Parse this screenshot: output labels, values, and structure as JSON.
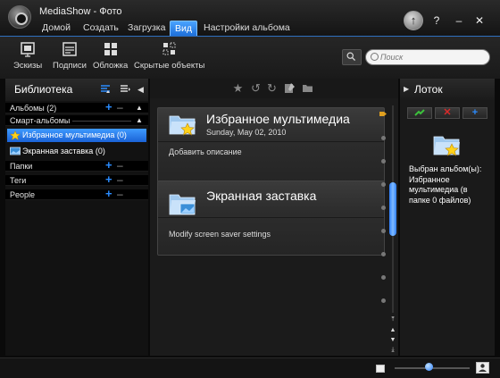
{
  "window": {
    "title": "MediaShow - Фото"
  },
  "menu": {
    "tabs": [
      "Домой",
      "Создать",
      "Загрузка",
      "Вид",
      "Настройки альбома"
    ],
    "active_tab": "Вид"
  },
  "window_controls": {
    "update": "↑",
    "help": "?",
    "minimize": "–",
    "close": "✕"
  },
  "toolbar": {
    "items": [
      "Эскизы",
      "Подписи",
      "Обложка",
      "Скрытые объекты"
    ]
  },
  "search": {
    "placeholder": "Поиск"
  },
  "library": {
    "title": "Библиотека",
    "sections": {
      "albums": "Альбомы (2)",
      "smart_albums": "Смарт-альбомы",
      "folders": "Папки",
      "tags": "Теги",
      "people": "People"
    },
    "items": [
      {
        "label": "Избранное мультимедиа (0)",
        "icon": "star-folder-icon",
        "selected": true
      },
      {
        "label": "Экранная заставка (0)",
        "icon": "screensaver-icon",
        "selected": false
      }
    ]
  },
  "albums": [
    {
      "name": "Избранное мультимедиа",
      "date": "Sunday, May 02, 2010",
      "description": "Добавить описание",
      "icon": "star-folder-icon"
    },
    {
      "name": "Экранная заставка",
      "date": "",
      "description": "Modify screen saver settings",
      "icon": "screensaver-folder-icon"
    }
  ],
  "tray": {
    "title": "Лоток",
    "info": "Выбран альбом(ы): Избранное мультимедиа (в папке 0 файлов)",
    "buttons": [
      "apply",
      "delete",
      "add"
    ]
  },
  "zoom": {
    "level": 0.45
  },
  "colors": {
    "accent": "#2a8cff",
    "selected": "#1a62d6",
    "danger": "#d92a2a",
    "ok": "#3cc23c"
  }
}
